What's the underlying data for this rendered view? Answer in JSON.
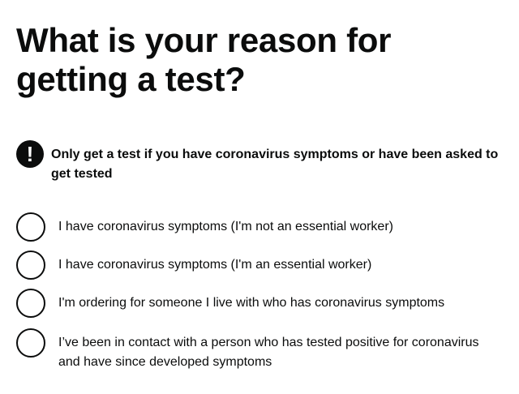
{
  "page": {
    "title": "What is your reason for getting a test?"
  },
  "warning": {
    "icon": "exclamation-icon",
    "icon_glyph": "!",
    "text": "Only get a test if you have coronavirus symptoms or have been asked to get tested"
  },
  "radios": [
    {
      "label": "I have coronavirus symptoms (I'm not an essential worker)",
      "checked": false
    },
    {
      "label": "I have coronavirus symptoms (I'm an essential worker)",
      "checked": false
    },
    {
      "label": "I'm ordering for someone I live with who has coronavirus symptoms",
      "checked": false
    },
    {
      "label": "I’ve been in contact with a person who has tested positive for coronavirus and have since developed symptoms",
      "checked": false
    }
  ],
  "colors": {
    "text": "#0b0c0c",
    "background": "#ffffff"
  }
}
